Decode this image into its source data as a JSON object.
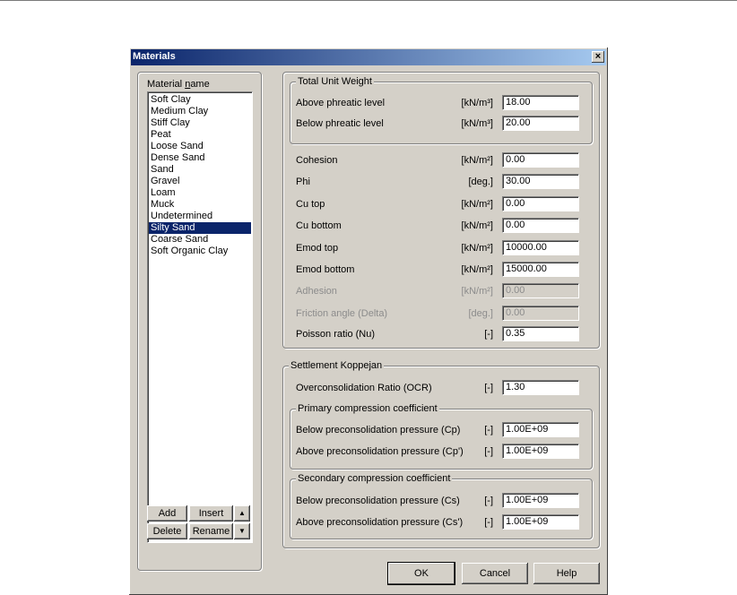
{
  "window": {
    "title": "Materials",
    "close_glyph": "×"
  },
  "materials": {
    "label_prefix": "Material ",
    "label_accel": "n",
    "label_suffix": "ame",
    "items": [
      "Soft Clay",
      "Medium Clay",
      "Stiff Clay",
      "Peat",
      "Loose Sand",
      "Dense Sand",
      "Sand",
      "Gravel",
      "Loam",
      "Muck",
      "Undetermined",
      "Silty Sand",
      "Coarse Sand",
      "Soft Organic Clay"
    ],
    "selected": "Silty Sand",
    "buttons": {
      "add": "Add",
      "insert": "Insert",
      "delete": "Delete",
      "rename": "Rename",
      "up": "▲",
      "down": "▼"
    }
  },
  "unit_weight": {
    "title": "Total Unit Weight",
    "above_label": "Above phreatic level",
    "above_unit": "[kN/m³]",
    "above_value": "18.00",
    "below_label": "Below phreatic level",
    "below_unit": "[kN/m³]",
    "below_value": "20.00"
  },
  "params": {
    "cohesion_label": "Cohesion",
    "cohesion_unit": "[kN/m²]",
    "cohesion_value": "0.00",
    "phi_label": "Phi",
    "phi_unit": "[deg.]",
    "phi_value": "30.00",
    "cutop_label": "Cu top",
    "cutop_unit": "[kN/m²]",
    "cutop_value": "0.00",
    "cubottom_label": "Cu bottom",
    "cubottom_unit": "[kN/m²]",
    "cubottom_value": "0.00",
    "emodtop_label": "Emod top",
    "emodtop_unit": "[kN/m²]",
    "emodtop_value": "10000.00",
    "emodbottom_label": "Emod bottom",
    "emodbottom_unit": "[kN/m²]",
    "emodbottom_value": "15000.00",
    "adhesion_label": "Adhesion",
    "adhesion_unit": "[kN/m²]",
    "adhesion_value": "0.00",
    "friction_label": "Friction angle (Delta)",
    "friction_unit": "[deg.]",
    "friction_value": "0.00",
    "poisson_label": "Poisson ratio (Nu)",
    "poisson_unit": "[-]",
    "poisson_value": "0.35"
  },
  "koppejan": {
    "title": "Settlement Koppejan",
    "ocr_label": "Overconsolidation Ratio (OCR)",
    "ocr_unit": "[-]",
    "ocr_value": "1.30",
    "primary_title": "Primary compression coefficient",
    "cp_label": "Below preconsolidation pressure (Cp)",
    "cp_unit": "[-]",
    "cp_value": "1.00E+09",
    "cpp_label": "Above preconsolidation pressure (Cp')",
    "cpp_unit": "[-]",
    "cpp_value": "1.00E+09",
    "secondary_title": "Secondary compression coefficient",
    "cs_label": "Below preconsolidation pressure (Cs)",
    "cs_unit": "[-]",
    "cs_value": "1.00E+09",
    "csp_label": "Above preconsolidation pressure (Cs')",
    "csp_unit": "[-]",
    "csp_value": "1.00E+09"
  },
  "footer": {
    "ok": "OK",
    "cancel": "Cancel",
    "help": "Help"
  }
}
